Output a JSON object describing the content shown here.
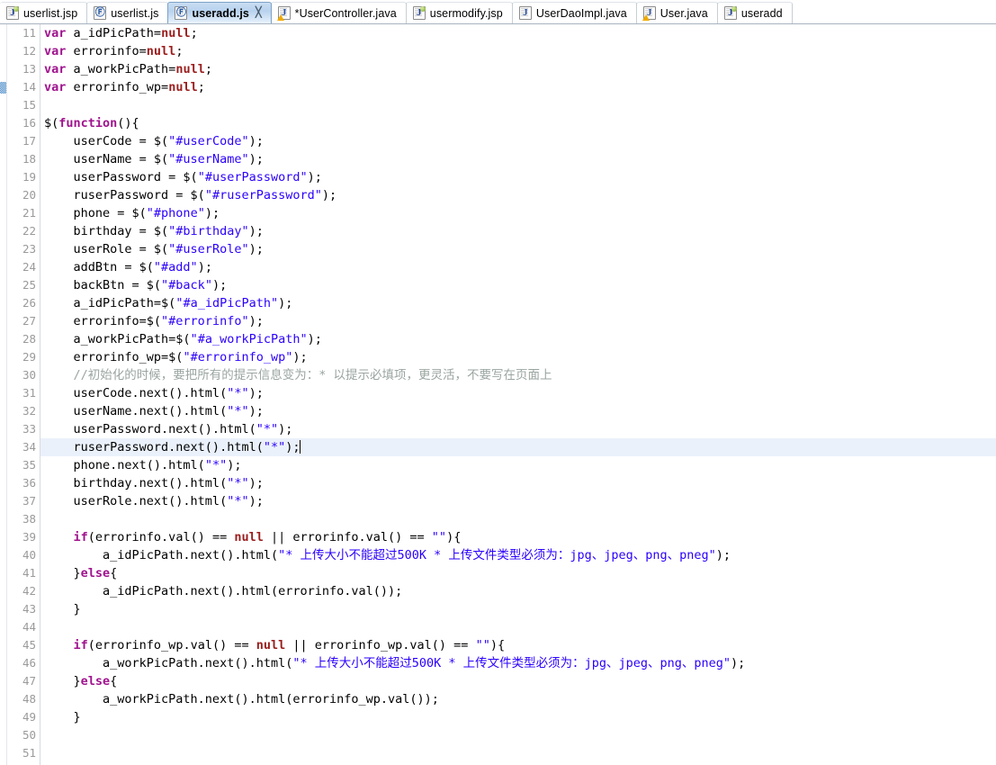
{
  "window": {
    "title": "useradd.js",
    "active_tab": "useradd.js"
  },
  "tabs": [
    {
      "label": "userlist.jsp",
      "icon": "jsp-file-icon",
      "type": "jsp",
      "active": false,
      "dirty": false,
      "warning": false,
      "closable": false
    },
    {
      "label": "userlist.js",
      "icon": "js-file-icon",
      "type": "js",
      "active": false,
      "dirty": false,
      "warning": false,
      "closable": false
    },
    {
      "label": "useradd.js",
      "icon": "js-file-icon",
      "type": "js",
      "active": true,
      "dirty": false,
      "warning": false,
      "closable": true,
      "close_glyph": "╳"
    },
    {
      "label": "*UserController.java",
      "icon": "java-file-warning-icon",
      "type": "java",
      "active": false,
      "dirty": true,
      "warning": true,
      "closable": false
    },
    {
      "label": "usermodify.jsp",
      "icon": "jsp-file-icon",
      "type": "jsp",
      "active": false,
      "dirty": false,
      "warning": false,
      "closable": false
    },
    {
      "label": "UserDaoImpl.java",
      "icon": "java-file-icon",
      "type": "java",
      "active": false,
      "dirty": false,
      "warning": false,
      "closable": false
    },
    {
      "label": "User.java",
      "icon": "java-file-warning-icon",
      "type": "java",
      "active": false,
      "dirty": false,
      "warning": true,
      "closable": false
    },
    {
      "label": "useradd",
      "icon": "jsp-file-icon",
      "type": "jsp",
      "active": false,
      "dirty": false,
      "warning": false,
      "closable": false
    }
  ],
  "editor": {
    "first_line": 11,
    "last_line": 51,
    "current_line": 34,
    "annotation_line": 14,
    "caret_line": 34,
    "colors": {
      "keyword": "#a0138e",
      "literal": "#9b1d1d",
      "string": "#2a00ff",
      "comment": "#9aa5a0",
      "plain": "#000000",
      "line_number": "#9a9a9a",
      "current_line_highlight": "#eaf1fb",
      "background": "#ffffff"
    },
    "lines": [
      {
        "n": 11,
        "tokens": [
          {
            "t": "kw",
            "s": "var"
          },
          {
            "t": "plain",
            "s": " a_idPicPath="
          },
          {
            "t": "lit",
            "s": "null"
          },
          {
            "t": "plain",
            "s": ";"
          }
        ]
      },
      {
        "n": 12,
        "tokens": [
          {
            "t": "kw",
            "s": "var"
          },
          {
            "t": "plain",
            "s": " errorinfo="
          },
          {
            "t": "lit",
            "s": "null"
          },
          {
            "t": "plain",
            "s": ";"
          }
        ]
      },
      {
        "n": 13,
        "tokens": [
          {
            "t": "kw",
            "s": "var"
          },
          {
            "t": "plain",
            "s": " a_workPicPath="
          },
          {
            "t": "lit",
            "s": "null"
          },
          {
            "t": "plain",
            "s": ";"
          }
        ]
      },
      {
        "n": 14,
        "tokens": [
          {
            "t": "kw",
            "s": "var"
          },
          {
            "t": "plain",
            "s": " errorinfo_wp="
          },
          {
            "t": "lit",
            "s": "null"
          },
          {
            "t": "plain",
            "s": ";"
          }
        ]
      },
      {
        "n": 15,
        "tokens": []
      },
      {
        "n": 16,
        "tokens": [
          {
            "t": "plain",
            "s": "$("
          },
          {
            "t": "kw",
            "s": "function"
          },
          {
            "t": "plain",
            "s": "(){"
          }
        ]
      },
      {
        "n": 17,
        "tokens": [
          {
            "t": "plain",
            "s": "    userCode = $("
          },
          {
            "t": "str",
            "s": "\"#userCode\""
          },
          {
            "t": "plain",
            "s": ");"
          }
        ]
      },
      {
        "n": 18,
        "tokens": [
          {
            "t": "plain",
            "s": "    userName = $("
          },
          {
            "t": "str",
            "s": "\"#userName\""
          },
          {
            "t": "plain",
            "s": ");"
          }
        ]
      },
      {
        "n": 19,
        "tokens": [
          {
            "t": "plain",
            "s": "    userPassword = $("
          },
          {
            "t": "str",
            "s": "\"#userPassword\""
          },
          {
            "t": "plain",
            "s": ");"
          }
        ]
      },
      {
        "n": 20,
        "tokens": [
          {
            "t": "plain",
            "s": "    ruserPassword = $("
          },
          {
            "t": "str",
            "s": "\"#ruserPassword\""
          },
          {
            "t": "plain",
            "s": ");"
          }
        ]
      },
      {
        "n": 21,
        "tokens": [
          {
            "t": "plain",
            "s": "    phone = $("
          },
          {
            "t": "str",
            "s": "\"#phone\""
          },
          {
            "t": "plain",
            "s": ");"
          }
        ]
      },
      {
        "n": 22,
        "tokens": [
          {
            "t": "plain",
            "s": "    birthday = $("
          },
          {
            "t": "str",
            "s": "\"#birthday\""
          },
          {
            "t": "plain",
            "s": ");"
          }
        ]
      },
      {
        "n": 23,
        "tokens": [
          {
            "t": "plain",
            "s": "    userRole = $("
          },
          {
            "t": "str",
            "s": "\"#userRole\""
          },
          {
            "t": "plain",
            "s": ");"
          }
        ]
      },
      {
        "n": 24,
        "tokens": [
          {
            "t": "plain",
            "s": "    addBtn = $("
          },
          {
            "t": "str",
            "s": "\"#add\""
          },
          {
            "t": "plain",
            "s": ");"
          }
        ]
      },
      {
        "n": 25,
        "tokens": [
          {
            "t": "plain",
            "s": "    backBtn = $("
          },
          {
            "t": "str",
            "s": "\"#back\""
          },
          {
            "t": "plain",
            "s": ");"
          }
        ]
      },
      {
        "n": 26,
        "tokens": [
          {
            "t": "plain",
            "s": "    a_idPicPath=$("
          },
          {
            "t": "str",
            "s": "\"#a_idPicPath\""
          },
          {
            "t": "plain",
            "s": ");"
          }
        ]
      },
      {
        "n": 27,
        "tokens": [
          {
            "t": "plain",
            "s": "    errorinfo=$("
          },
          {
            "t": "str",
            "s": "\"#errorinfo\""
          },
          {
            "t": "plain",
            "s": ");"
          }
        ]
      },
      {
        "n": 28,
        "tokens": [
          {
            "t": "plain",
            "s": "    a_workPicPath=$("
          },
          {
            "t": "str",
            "s": "\"#a_workPicPath\""
          },
          {
            "t": "plain",
            "s": ");"
          }
        ]
      },
      {
        "n": 29,
        "tokens": [
          {
            "t": "plain",
            "s": "    errorinfo_wp=$("
          },
          {
            "t": "str",
            "s": "\"#errorinfo_wp\""
          },
          {
            "t": "plain",
            "s": ");"
          }
        ]
      },
      {
        "n": 30,
        "tokens": [
          {
            "t": "cmt",
            "s": "    //初始化的时候，要把所有的提示信息变为：* 以提示必填项，更灵活，不要写在页面上"
          }
        ]
      },
      {
        "n": 31,
        "tokens": [
          {
            "t": "plain",
            "s": "    userCode.next().html("
          },
          {
            "t": "str",
            "s": "\"*\""
          },
          {
            "t": "plain",
            "s": ");"
          }
        ]
      },
      {
        "n": 32,
        "tokens": [
          {
            "t": "plain",
            "s": "    userName.next().html("
          },
          {
            "t": "str",
            "s": "\"*\""
          },
          {
            "t": "plain",
            "s": ");"
          }
        ]
      },
      {
        "n": 33,
        "tokens": [
          {
            "t": "plain",
            "s": "    userPassword.next().html("
          },
          {
            "t": "str",
            "s": "\"*\""
          },
          {
            "t": "plain",
            "s": ");"
          }
        ]
      },
      {
        "n": 34,
        "tokens": [
          {
            "t": "plain",
            "s": "    ruserPassword.next().html("
          },
          {
            "t": "str",
            "s": "\"*\""
          },
          {
            "t": "plain",
            "s": ");"
          }
        ],
        "caret": true
      },
      {
        "n": 35,
        "tokens": [
          {
            "t": "plain",
            "s": "    phone.next().html("
          },
          {
            "t": "str",
            "s": "\"*\""
          },
          {
            "t": "plain",
            "s": ");"
          }
        ]
      },
      {
        "n": 36,
        "tokens": [
          {
            "t": "plain",
            "s": "    birthday.next().html("
          },
          {
            "t": "str",
            "s": "\"*\""
          },
          {
            "t": "plain",
            "s": ");"
          }
        ]
      },
      {
        "n": 37,
        "tokens": [
          {
            "t": "plain",
            "s": "    userRole.next().html("
          },
          {
            "t": "str",
            "s": "\"*\""
          },
          {
            "t": "plain",
            "s": ");"
          }
        ]
      },
      {
        "n": 38,
        "tokens": []
      },
      {
        "n": 39,
        "tokens": [
          {
            "t": "plain",
            "s": "    "
          },
          {
            "t": "kw",
            "s": "if"
          },
          {
            "t": "plain",
            "s": "(errorinfo.val() == "
          },
          {
            "t": "lit",
            "s": "null"
          },
          {
            "t": "plain",
            "s": " || errorinfo.val() == "
          },
          {
            "t": "str",
            "s": "\"\""
          },
          {
            "t": "plain",
            "s": "){"
          }
        ]
      },
      {
        "n": 40,
        "tokens": [
          {
            "t": "plain",
            "s": "        a_idPicPath.next().html("
          },
          {
            "t": "str",
            "s": "\"* 上传大小不能超过500K * 上传文件类型必须为：jpg、jpeg、png、pneg\""
          },
          {
            "t": "plain",
            "s": ");"
          }
        ]
      },
      {
        "n": 41,
        "tokens": [
          {
            "t": "plain",
            "s": "    }"
          },
          {
            "t": "kw",
            "s": "else"
          },
          {
            "t": "plain",
            "s": "{"
          }
        ]
      },
      {
        "n": 42,
        "tokens": [
          {
            "t": "plain",
            "s": "        a_idPicPath.next().html(errorinfo.val());"
          }
        ]
      },
      {
        "n": 43,
        "tokens": [
          {
            "t": "plain",
            "s": "    }"
          }
        ]
      },
      {
        "n": 44,
        "tokens": []
      },
      {
        "n": 45,
        "tokens": [
          {
            "t": "plain",
            "s": "    "
          },
          {
            "t": "kw",
            "s": "if"
          },
          {
            "t": "plain",
            "s": "(errorinfo_wp.val() == "
          },
          {
            "t": "lit",
            "s": "null"
          },
          {
            "t": "plain",
            "s": " || errorinfo_wp.val() == "
          },
          {
            "t": "str",
            "s": "\"\""
          },
          {
            "t": "plain",
            "s": "){"
          }
        ]
      },
      {
        "n": 46,
        "tokens": [
          {
            "t": "plain",
            "s": "        a_workPicPath.next().html("
          },
          {
            "t": "str",
            "s": "\"* 上传大小不能超过500K * 上传文件类型必须为：jpg、jpeg、png、pneg\""
          },
          {
            "t": "plain",
            "s": ");"
          }
        ]
      },
      {
        "n": 47,
        "tokens": [
          {
            "t": "plain",
            "s": "    }"
          },
          {
            "t": "kw",
            "s": "else"
          },
          {
            "t": "plain",
            "s": "{"
          }
        ]
      },
      {
        "n": 48,
        "tokens": [
          {
            "t": "plain",
            "s": "        a_workPicPath.next().html(errorinfo_wp.val());"
          }
        ]
      },
      {
        "n": 49,
        "tokens": [
          {
            "t": "plain",
            "s": "    }"
          }
        ]
      },
      {
        "n": 50,
        "tokens": []
      },
      {
        "n": 51,
        "tokens": []
      }
    ]
  }
}
